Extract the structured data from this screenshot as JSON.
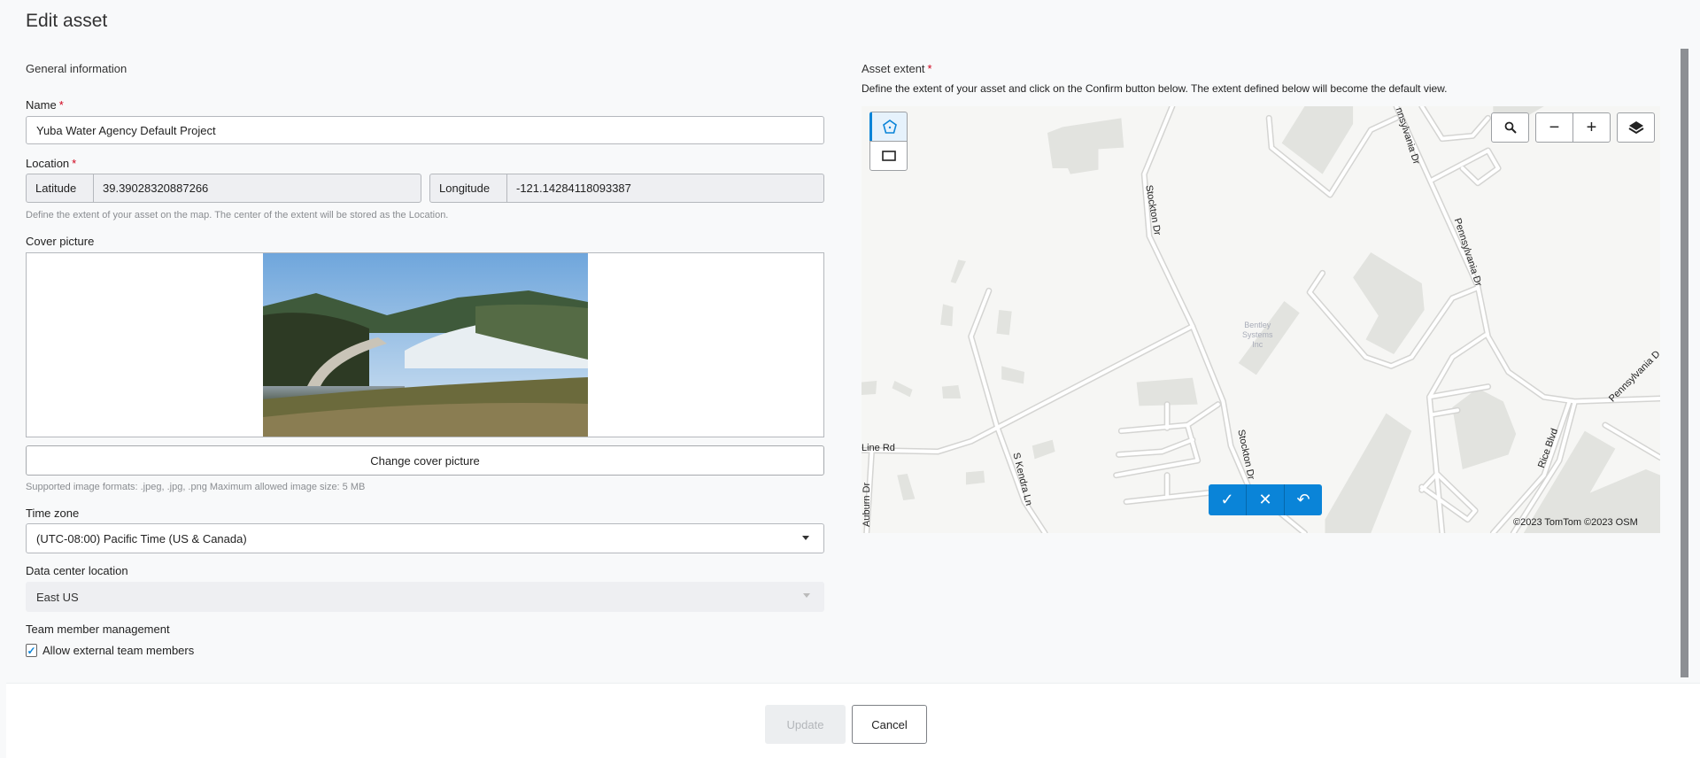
{
  "header": {
    "title": "Edit asset"
  },
  "form": {
    "section": "General information",
    "name": {
      "label": "Name",
      "required": "*",
      "value": "Yuba Water Agency Default Project"
    },
    "location": {
      "label": "Location",
      "required": "*",
      "lat_label": "Latitude",
      "lat_value": "39.39028320887266",
      "lon_label": "Longitude",
      "lon_value": "-121.14284118093387",
      "hint": "Define the extent of your asset on the map. The center of the extent will be stored as the Location."
    },
    "cover": {
      "label": "Cover picture",
      "button": "Change cover picture",
      "hint": "Supported image formats: .jpeg, .jpg, .png Maximum allowed image size: 5 MB"
    },
    "timezone": {
      "label": "Time zone",
      "value": "(UTC-08:00) Pacific Time (US & Canada)"
    },
    "datacenter": {
      "label": "Data center location",
      "value": "East US"
    },
    "team": {
      "label": "Team member management",
      "checkbox": "Allow external team members",
      "checked": true
    }
  },
  "extent": {
    "label": "Asset extent",
    "required": "*",
    "description": "Define the extent of your asset and click on the Confirm button below. The extent defined below will become the default view.",
    "map": {
      "attribution": "©2023 TomTom ©2023 OSM",
      "labels": {
        "stockton1": "Stockton Dr",
        "stockton2": "Stockton Dr",
        "penn1": "nnsylvania Dr",
        "penn2": "Pennsylvania Dr",
        "penn3": "Pennsylvania D",
        "linerd": "Line Rd",
        "kendra": "S Kendra Ln",
        "auburn": "Auburn Dr",
        "rice": "Rice Blvd",
        "bentley1": "Bentley",
        "bentley2": "Systems",
        "bentley3": "Inc"
      },
      "icons": {
        "polygon": "pentagon-draw-icon",
        "rectangle": "rectangle-draw-icon",
        "search": "search-icon",
        "zoom_out": "minus-icon",
        "zoom_in": "plus-icon",
        "layers": "layers-icon",
        "confirm": "check-icon",
        "cancel": "close-icon",
        "undo": "undo-icon"
      }
    }
  },
  "footer": {
    "update": "Update",
    "cancel": "Cancel"
  },
  "colors": {
    "accent": "#0a84d8",
    "required": "#d0021b"
  }
}
